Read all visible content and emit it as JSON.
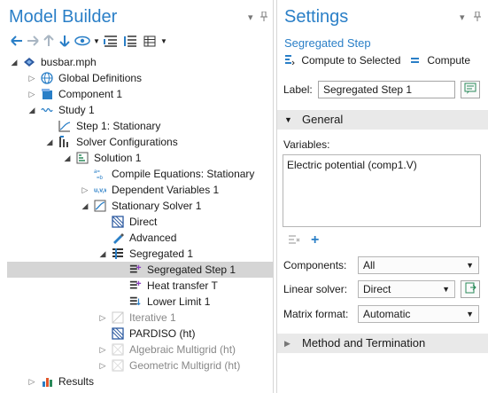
{
  "model_builder": {
    "title": "Model Builder",
    "toolbar_icons": [
      "arrow-left-icon",
      "arrow-right-icon",
      "arrow-up-icon",
      "arrow-down-icon",
      "show-icon",
      "chevron-down-icon",
      "collapse-icon",
      "expand-icon",
      "list-icon",
      "chevron-down-icon"
    ],
    "tree": [
      {
        "label": "busbar.mph",
        "depth": 0,
        "expand": "open",
        "icon": "model-icon"
      },
      {
        "label": "Global Definitions",
        "depth": 1,
        "expand": "closed",
        "icon": "globe-icon"
      },
      {
        "label": "Component 1",
        "depth": 1,
        "expand": "closed",
        "icon": "component-icon"
      },
      {
        "label": "Study 1",
        "depth": 1,
        "expand": "open",
        "icon": "study-icon"
      },
      {
        "label": "Step 1: Stationary",
        "depth": 2,
        "expand": "none",
        "icon": "step-icon"
      },
      {
        "label": "Solver Configurations",
        "depth": 2,
        "expand": "open",
        "icon": "solver-config-icon"
      },
      {
        "label": "Solution 1",
        "depth": 3,
        "expand": "open",
        "icon": "solution-icon"
      },
      {
        "label": "Compile Equations: Stationary",
        "depth": 4,
        "expand": "none",
        "icon": "compile-icon"
      },
      {
        "label": "Dependent Variables 1",
        "depth": 4,
        "expand": "closed",
        "icon": "variables-icon"
      },
      {
        "label": "Stationary Solver 1",
        "depth": 4,
        "expand": "open",
        "icon": "stationary-solver-icon"
      },
      {
        "label": "Direct",
        "depth": 5,
        "expand": "none",
        "icon": "direct-icon"
      },
      {
        "label": "Advanced",
        "depth": 5,
        "expand": "none",
        "icon": "advanced-icon"
      },
      {
        "label": "Segregated 1",
        "depth": 5,
        "expand": "open",
        "icon": "segregated-icon"
      },
      {
        "label": "Segregated Step 1",
        "depth": 6,
        "expand": "none",
        "icon": "segregated-step-icon",
        "selected": true
      },
      {
        "label": "Heat transfer T",
        "depth": 6,
        "expand": "none",
        "icon": "segregated-step-icon"
      },
      {
        "label": "Lower Limit 1",
        "depth": 6,
        "expand": "none",
        "icon": "lower-limit-icon"
      },
      {
        "label": "Iterative 1",
        "depth": 5,
        "expand": "closed",
        "icon": "iterative-icon",
        "disabled": true
      },
      {
        "label": "PARDISO (ht)",
        "depth": 5,
        "expand": "none",
        "icon": "direct-icon"
      },
      {
        "label": "Algebraic Multigrid (ht)",
        "depth": 5,
        "expand": "closed",
        "icon": "multigrid-icon",
        "disabled": true
      },
      {
        "label": "Geometric Multigrid (ht)",
        "depth": 5,
        "expand": "closed",
        "icon": "multigrid-icon",
        "disabled": true
      },
      {
        "label": "Results",
        "depth": 1,
        "expand": "closed",
        "icon": "results-icon"
      }
    ]
  },
  "settings": {
    "title": "Settings",
    "subtitle": "Segregated Step",
    "compute_selected": "Compute to Selected",
    "compute": "Compute",
    "label_caption": "Label:",
    "label_value": "Segregated Step 1",
    "general_section": "General",
    "variables_caption": "Variables:",
    "variables_list": [
      "Electric potential (comp1.V)"
    ],
    "components_caption": "Components:",
    "components_value": "All",
    "linear_solver_caption": "Linear solver:",
    "linear_solver_value": "Direct",
    "matrix_format_caption": "Matrix format:",
    "matrix_format_value": "Automatic",
    "method_section": "Method and Termination"
  },
  "colors": {
    "accent": "#2a7fc7",
    "selection": "#d5d5d5",
    "section_bg": "#e9e9e9"
  }
}
